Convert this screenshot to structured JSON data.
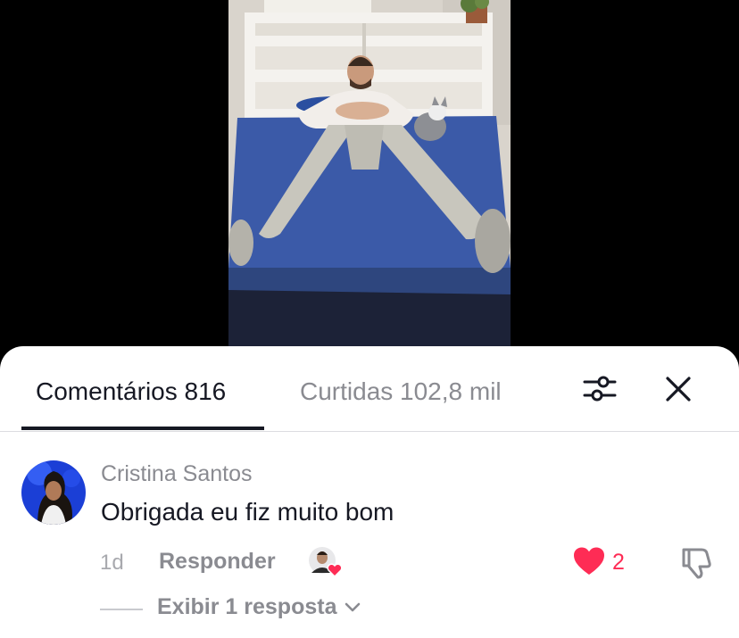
{
  "tabs": {
    "comments_label": "Comentários 816",
    "likes_label": "Curtidas 102,8 mil"
  },
  "icons": {
    "filter": "sliders-icon",
    "close": "close-icon",
    "like": "heart-icon",
    "dislike": "thumbs-down-icon",
    "expand": "chevron-down-icon",
    "creator_liked": "creator-liked-avatar-icon"
  },
  "colors": {
    "accent_like": "#fe2c55",
    "text_primary": "#161823",
    "text_secondary": "#8a8b91"
  },
  "comment": {
    "author": "Cristina Santos",
    "text": "Obrigada eu fiz muito bom",
    "time": "1d",
    "reply_label": "Responder",
    "like_count": "2",
    "view_replies_label": "Exibir 1 resposta"
  }
}
